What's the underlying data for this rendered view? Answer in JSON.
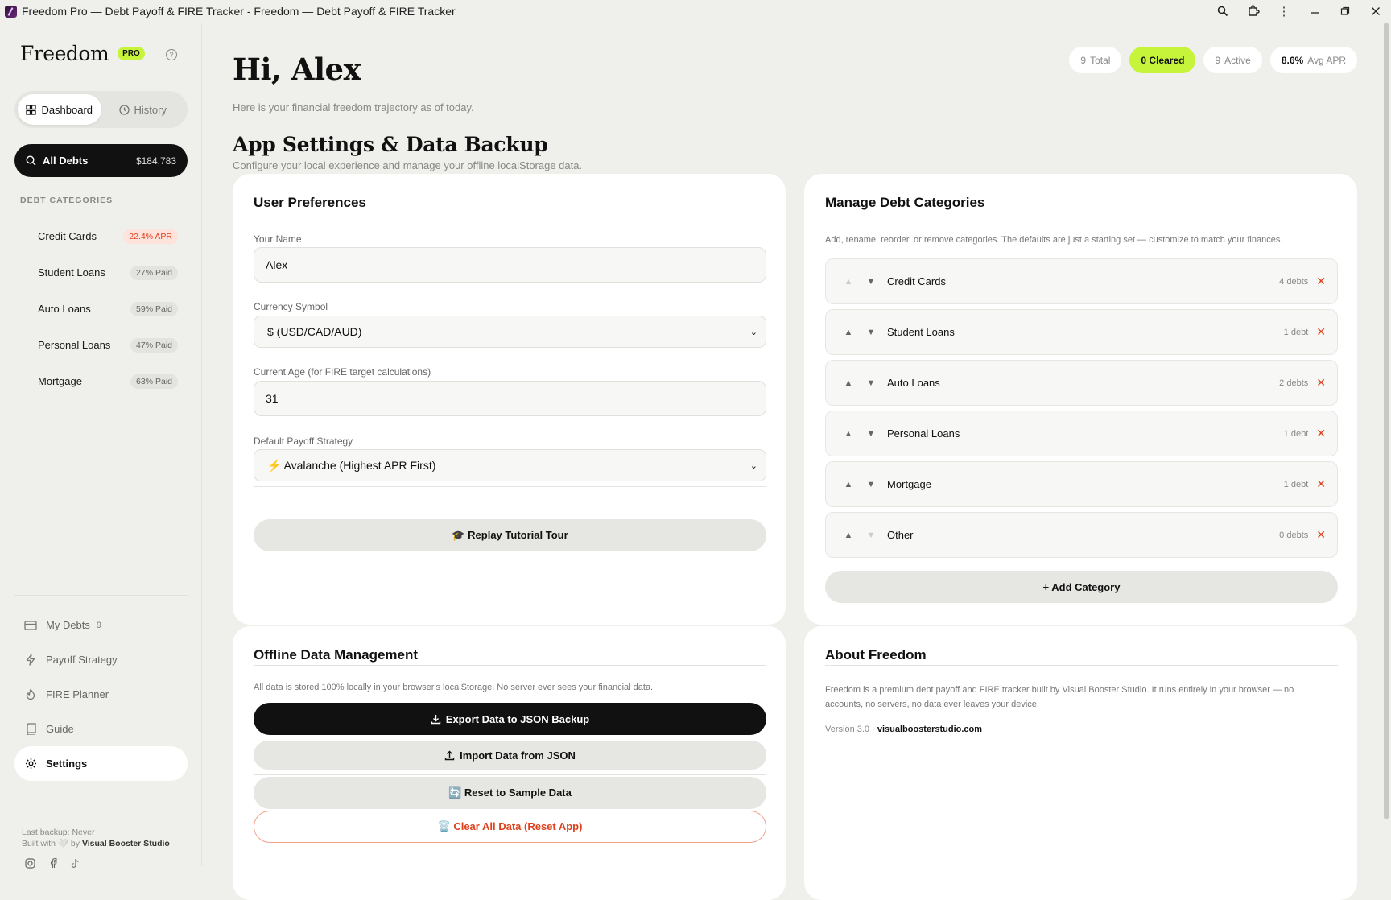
{
  "window": {
    "title": "Freedom Pro — Debt Payoff & FIRE Tracker - Freedom — Debt Payoff & FIRE Tracker"
  },
  "sidebar": {
    "brand": "Freedom",
    "pro": "PRO",
    "help": "?",
    "tabs": [
      {
        "label": "Dashboard"
      },
      {
        "label": "History"
      }
    ],
    "all_debts": {
      "label": "All Debts",
      "amount": "$184,783"
    },
    "categories_heading": "DEBT CATEGORIES",
    "categories": [
      {
        "name": "Credit Cards",
        "badge": "22.4% APR"
      },
      {
        "name": "Student Loans",
        "badge": "27% Paid"
      },
      {
        "name": "Auto Loans",
        "badge": "59% Paid"
      },
      {
        "name": "Personal Loans",
        "badge": "47% Paid"
      },
      {
        "name": "Mortgage",
        "badge": "63% Paid"
      }
    ],
    "nav": [
      {
        "label": "My Debts",
        "count": "9"
      },
      {
        "label": "Payoff Strategy"
      },
      {
        "label": "FIRE Planner"
      },
      {
        "label": "Guide"
      },
      {
        "label": "Settings"
      }
    ],
    "footer": {
      "backup": "Last backup: Never",
      "built_prefix": "Built with 🤍 by",
      "built_by": "Visual Booster Studio"
    }
  },
  "header": {
    "greeting": "Hi, Alex",
    "subtitle": "Here is your financial freedom trajectory as of today.",
    "chips": {
      "total_n": "9",
      "total_l": "Total",
      "cleared": "0 Cleared",
      "active_n": "9",
      "active_l": "Active",
      "apr_n": "8.6%",
      "apr_l": "Avg APR"
    }
  },
  "settings": {
    "title": "App Settings & Data Backup",
    "subtitle": "Configure your local experience and manage your offline localStorage data.",
    "prefs": {
      "title": "User Preferences",
      "name_label": "Your Name",
      "name_value": "Alex",
      "currency_label": "Currency Symbol",
      "currency_value": "$ (USD/CAD/AUD)",
      "age_label": "Current Age (for FIRE target calculations)",
      "age_value": "31",
      "strategy_label": "Default Payoff Strategy",
      "strategy_value": "⚡ Avalanche (Highest APR First)",
      "tour_button": "🎓 Replay Tutorial Tour"
    },
    "manage": {
      "title": "Manage Debt Categories",
      "desc": "Add, rename, reorder, or remove categories. The defaults are just a starting set — customize to match your finances.",
      "rows": [
        {
          "name": "Credit Cards",
          "count": "4 debts"
        },
        {
          "name": "Student Loans",
          "count": "1 debt"
        },
        {
          "name": "Auto Loans",
          "count": "2 debts"
        },
        {
          "name": "Personal Loans",
          "count": "1 debt"
        },
        {
          "name": "Mortgage",
          "count": "1 debt"
        },
        {
          "name": "Other",
          "count": "0 debts"
        }
      ],
      "add_button": "+ Add Category"
    },
    "offline": {
      "title": "Offline Data Management",
      "desc": "All data is stored 100% locally in your browser's localStorage. No server ever sees your financial data.",
      "export": "Export Data to JSON Backup",
      "import": "Import Data from JSON",
      "reset": "🔄 Reset to Sample Data",
      "clear": "🗑️ Clear All Data (Reset App)"
    },
    "about": {
      "title": "About Freedom",
      "text": "Freedom is a premium debt payoff and FIRE tracker built by Visual Booster Studio. It runs entirely in your browser — no accounts, no servers, no data ever leaves your device.",
      "version": "Version 3.0 ·",
      "site": "visualboosterstudio.com"
    }
  }
}
